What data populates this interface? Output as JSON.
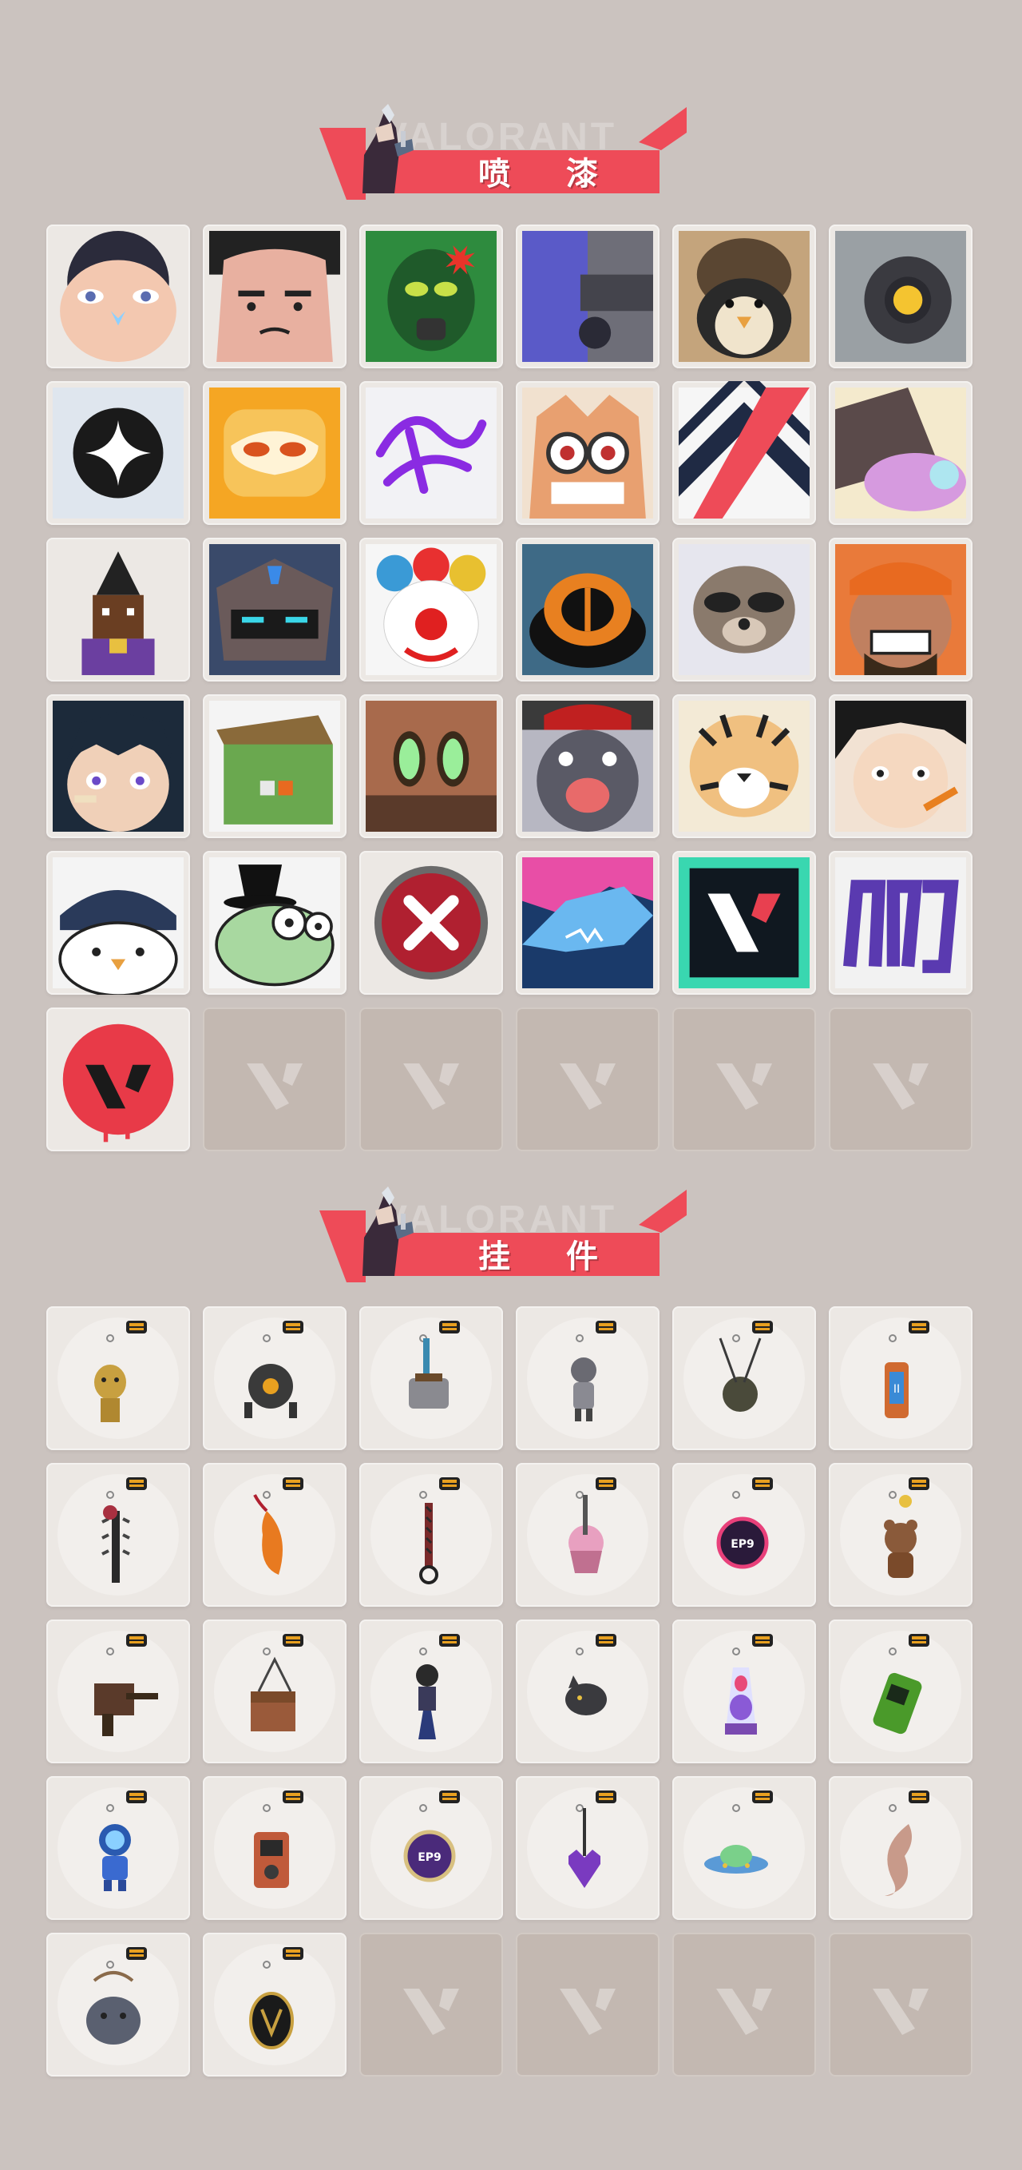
{
  "colors": {
    "background": "#cbc3bf",
    "accent": "#ee4b58",
    "tile": "#ece8e4",
    "empty_tile": "#c3b8b1"
  },
  "sections": [
    {
      "title": "喷 漆",
      "watermark": "VALORANT",
      "items": [
        {
          "name": "spray-butterfly-face",
          "icon": "face-butterfly",
          "bg": "#f3c8b0"
        },
        {
          "name": "spray-angry-guy",
          "icon": "face-angry",
          "bg": "#e8b8a0"
        },
        {
          "name": "spray-green-mask",
          "icon": "green-mask",
          "bg": "#2e8b3e"
        },
        {
          "name": "spray-purple-gun",
          "icon": "purple-gun",
          "bg": "#5a5ac8"
        },
        {
          "name": "spray-penguin-beanie",
          "icon": "penguin",
          "bg": "#c4a47c"
        },
        {
          "name": "spray-robot-eye",
          "icon": "robot-eye",
          "bg": "#9aa0a4"
        },
        {
          "name": "spray-black-star",
          "icon": "star-badge",
          "bg": "#dfe6ee"
        },
        {
          "name": "spray-orange-mask",
          "icon": "orange-mask",
          "bg": "#f5a623"
        },
        {
          "name": "spray-purple-scribble",
          "icon": "scribble",
          "bg": "#f2f2f5"
        },
        {
          "name": "spray-goggles-man",
          "icon": "goggles-face",
          "bg": "#f1e1cf"
        },
        {
          "name": "spray-chevron",
          "icon": "chevron",
          "bg": "#1f2a44"
        },
        {
          "name": "spray-pink-tail",
          "icon": "pink-creature",
          "bg": "#f4eacd"
        },
        {
          "name": "spray-pixel-agent",
          "icon": "pixel-agent",
          "bg": "#ece8e4"
        },
        {
          "name": "spray-armored-bot",
          "icon": "armored-bot",
          "bg": "#3a4a6a"
        },
        {
          "name": "spray-clown",
          "icon": "clown",
          "bg": "#f6f6f6"
        },
        {
          "name": "spray-top-hat",
          "icon": "top-hat",
          "bg": "#3e6a86"
        },
        {
          "name": "spray-raccoon",
          "icon": "raccoon",
          "bg": "#e6e6ee"
        },
        {
          "name": "spray-grinning-man",
          "icon": "grin-man",
          "bg": "#e97a3a"
        },
        {
          "name": "spray-bandaged-kid",
          "icon": "kid-face",
          "bg": "#1c2a3a"
        },
        {
          "name": "spray-green-crate",
          "icon": "green-crate",
          "bg": "#6aa84f"
        },
        {
          "name": "spray-green-eyes",
          "icon": "green-eyes",
          "bg": "#a86a4c"
        },
        {
          "name": "spray-crying-mole",
          "icon": "crying-mole",
          "bg": "#b7b7c2"
        },
        {
          "name": "spray-tiger",
          "icon": "tiger",
          "bg": "#f3ead6"
        },
        {
          "name": "spray-girl-pencil",
          "icon": "girl-pencil",
          "bg": "#f2e2d3"
        },
        {
          "name": "spray-penguin-peek",
          "icon": "penguin-peek",
          "bg": "#f4f4f4"
        },
        {
          "name": "spray-witch-frog",
          "icon": "witch-frog",
          "bg": "#f4f4f4"
        },
        {
          "name": "spray-x-button",
          "icon": "x-circle",
          "bg": "#ece8e4"
        },
        {
          "name": "spray-shark",
          "icon": "shark",
          "bg": "#e84ea6"
        },
        {
          "name": "spray-v-teal",
          "icon": "v-logo-teal",
          "bg": "#39d7b0"
        },
        {
          "name": "spray-graffiti-tag",
          "icon": "graffiti",
          "bg": "#f2f2f2"
        },
        {
          "name": "spray-v-red-drip",
          "icon": "v-logo-red",
          "bg": "#ece8e4"
        }
      ],
      "empty_slots": 5
    },
    {
      "title": "挂 件",
      "watermark": "VALORANT",
      "items": [
        {
          "name": "charm-gold-cat",
          "icon": "gold-cat"
        },
        {
          "name": "charm-drone",
          "icon": "drone"
        },
        {
          "name": "charm-toaster",
          "icon": "toaster"
        },
        {
          "name": "charm-raccoon-figure",
          "icon": "raccoon-figure"
        },
        {
          "name": "charm-canteen",
          "icon": "canteen"
        },
        {
          "name": "charm-blue-bottle",
          "icon": "blue-bottle"
        },
        {
          "name": "charm-spiked-mace",
          "icon": "spiked-mace"
        },
        {
          "name": "charm-chili-fish",
          "icon": "chili"
        },
        {
          "name": "charm-rope-knot",
          "icon": "rope"
        },
        {
          "name": "charm-cupcake",
          "icon": "cupcake"
        },
        {
          "name": "charm-ep9-medal-pink",
          "icon": "ep9-medal"
        },
        {
          "name": "charm-teddy-bell",
          "icon": "teddy"
        },
        {
          "name": "charm-brown-gun",
          "icon": "brown-gun"
        },
        {
          "name": "charm-crate-box",
          "icon": "crate-box"
        },
        {
          "name": "charm-tassel-figure",
          "icon": "tassel-figure"
        },
        {
          "name": "charm-dark-cat",
          "icon": "dark-cat"
        },
        {
          "name": "charm-lava-lamp",
          "icon": "lava-lamp"
        },
        {
          "name": "charm-green-device",
          "icon": "green-device"
        },
        {
          "name": "charm-blue-astronaut",
          "icon": "astronaut"
        },
        {
          "name": "charm-radio",
          "icon": "radio"
        },
        {
          "name": "charm-ep9-medal-purple",
          "icon": "ep9-medal-purple"
        },
        {
          "name": "charm-pixel-heart",
          "icon": "pixel-heart"
        },
        {
          "name": "charm-ufo",
          "icon": "ufo"
        },
        {
          "name": "charm-fish-tail",
          "icon": "fish-tail"
        },
        {
          "name": "charm-grey-owl",
          "icon": "grey-owl"
        },
        {
          "name": "charm-v-coin",
          "icon": "v-coin"
        }
      ],
      "empty_slots": 4
    }
  ]
}
